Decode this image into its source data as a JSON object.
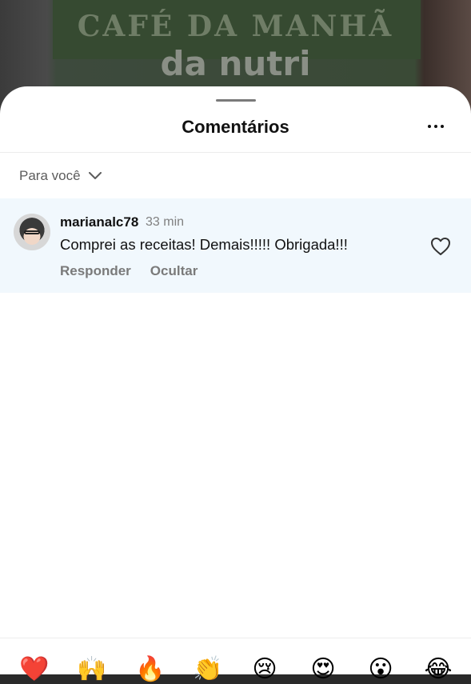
{
  "background": {
    "title": "CAFÉ DA MANHÃ",
    "subtitle": "da nutri"
  },
  "header": {
    "title": "Comentários",
    "more_icon": "more-horizontal-icon"
  },
  "filter": {
    "label": "Para você",
    "icon": "chevron-down-icon"
  },
  "comments": [
    {
      "username": "marianalc78",
      "time": "33 min",
      "text": "Comprei as receitas! Demais!!!!! Obrigada!!!",
      "reply_label": "Responder",
      "hide_label": "Ocultar",
      "like_icon": "heart-outline-icon"
    }
  ],
  "emoji_bar": {
    "emojis": [
      "❤️",
      "🙌",
      "🔥",
      "👏",
      "😢",
      "😍",
      "😮",
      "😂"
    ]
  },
  "colors": {
    "highlight_bg": "#f1f8fd",
    "text_primary": "#111111",
    "text_secondary": "#7a7a7a"
  }
}
